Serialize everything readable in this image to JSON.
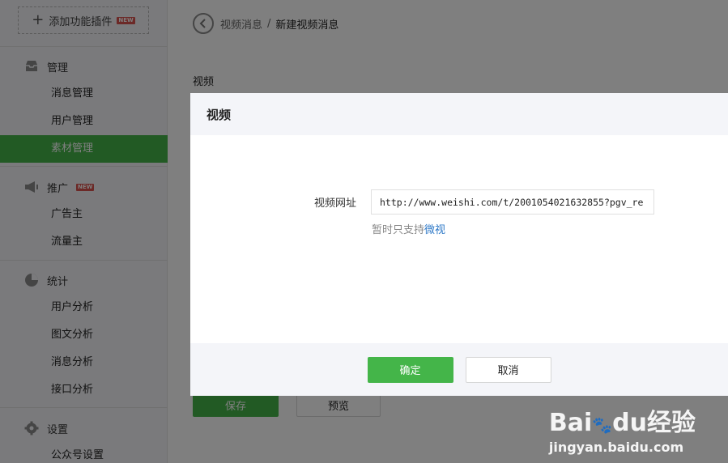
{
  "sidebar": {
    "add_plugin_label": "添加功能插件",
    "new_badge": "NEW",
    "groups": [
      {
        "title": "管理",
        "icon": "inbox-icon",
        "items": [
          "消息管理",
          "用户管理",
          "素材管理"
        ],
        "active_item": "素材管理"
      },
      {
        "title": "推广",
        "icon": "megaphone-icon",
        "badge": "NEW",
        "items": [
          "广告主",
          "流量主"
        ]
      },
      {
        "title": "统计",
        "icon": "pie-chart-icon",
        "items": [
          "用户分析",
          "图文分析",
          "消息分析",
          "接口分析"
        ]
      },
      {
        "title": "设置",
        "icon": "gear-icon",
        "items": [
          "公众号设置"
        ]
      }
    ]
  },
  "breadcrumb": {
    "back_icon": "chevron-left-icon",
    "parent": "视频消息",
    "separator": "/",
    "current": "新建视频消息"
  },
  "main": {
    "section_label": "视频",
    "save_label": "保存",
    "preview_label": "预览"
  },
  "dialog": {
    "title": "视频",
    "field_label": "视频网址",
    "url_value": "http://www.weishi.com/t/2001054021632855?pgv_re",
    "hint_prefix": "暂时只支持",
    "hint_link": "微视",
    "ok_label": "确定",
    "cancel_label": "取消"
  },
  "watermark": {
    "logo_left": "Bai",
    "logo_right": "du",
    "logo_suffix": "经验",
    "site": "jingyan.baidu.com"
  },
  "colors": {
    "accent": "#44b549",
    "link": "#2d78c7",
    "sidebar_bg": "#f4f5f9",
    "badge": "#d9534f"
  }
}
